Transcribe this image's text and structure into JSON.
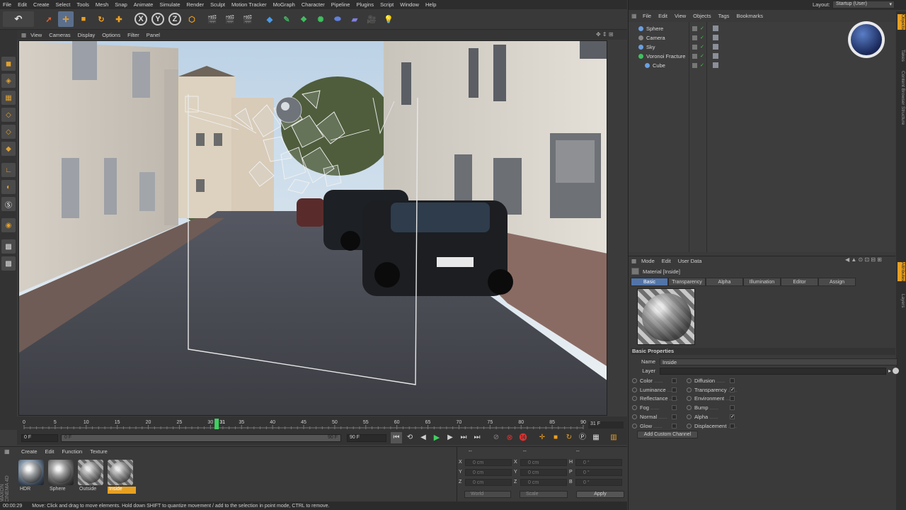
{
  "menu": [
    "File",
    "Edit",
    "Create",
    "Select",
    "Tools",
    "Mesh",
    "Snap",
    "Animate",
    "Simulate",
    "Render",
    "Sculpt",
    "Motion Tracker",
    "MoGraph",
    "Character",
    "Pipeline",
    "Plugins",
    "Script",
    "Window",
    "Help"
  ],
  "toolbar": {
    "axis_x": "X",
    "axis_y": "Y",
    "axis_z": "Z"
  },
  "viewport_menu": [
    "View",
    "Cameras",
    "Display",
    "Options",
    "Filter",
    "Panel"
  ],
  "timeline": {
    "ticks": [
      "0",
      "5",
      "10",
      "15",
      "20",
      "25",
      "30",
      "35",
      "40",
      "45",
      "50",
      "55",
      "60",
      "65",
      "70",
      "75",
      "80",
      "85",
      "90"
    ],
    "current_marker": "31",
    "end_frame_label": "31 F",
    "start_field": "0 F",
    "range_start": "0 F",
    "range_end": "90 F",
    "end_field": "90 F"
  },
  "material_manager": {
    "menu": [
      "Create",
      "Edit",
      "Function",
      "Texture"
    ],
    "materials": [
      {
        "name": "HDR",
        "selected": false
      },
      {
        "name": "Sphere",
        "selected": false
      },
      {
        "name": "Outside",
        "selected": false
      },
      {
        "name": "Inside",
        "selected": true
      }
    ]
  },
  "coordinates": {
    "header_a": "--",
    "header_b": "--",
    "header_c": "--",
    "rows": [
      {
        "a": "X",
        "av": "0 cm",
        "b": "X",
        "bv": "0 cm",
        "c": "H",
        "cv": "0 °"
      },
      {
        "a": "Y",
        "av": "0 cm",
        "b": "Y",
        "bv": "0 cm",
        "c": "P",
        "cv": "0 °"
      },
      {
        "a": "Z",
        "av": "0 cm",
        "b": "Z",
        "bv": "0 cm",
        "c": "B",
        "cv": "0 °"
      }
    ],
    "mode": "World",
    "scale": "Scale",
    "apply": "Apply"
  },
  "status": {
    "time": "00:00:29",
    "message": "Move: Click and drag to move elements. Hold down SHIFT to quantize movement / add to the selection in point mode, CTRL to remove."
  },
  "layout": {
    "label": "Layout:",
    "value": "Startup (User)"
  },
  "object_manager": {
    "menu": [
      "File",
      "Edit",
      "View",
      "Objects",
      "Tags",
      "Bookmarks"
    ],
    "objects": [
      {
        "name": "Sphere",
        "color": "#6aa0e0",
        "indent": 0
      },
      {
        "name": "Camera",
        "color": "#888888",
        "indent": 0
      },
      {
        "name": "Sky",
        "color": "#6aa0e0",
        "indent": 0
      },
      {
        "name": "Voronoi Fracture",
        "color": "#40c060",
        "indent": 0
      },
      {
        "name": "Cube",
        "color": "#6aa0e0",
        "indent": 1
      }
    ]
  },
  "side_tabs": [
    "Objects",
    "Takes",
    "Content Browser",
    "Structure",
    "Attributes",
    "Layers"
  ],
  "attributes": {
    "menu": [
      "Mode",
      "Edit",
      "User Data"
    ],
    "title": "Material [Inside]",
    "tabs": [
      {
        "label": "Basic",
        "active": true
      },
      {
        "label": "Transparency",
        "active": false
      },
      {
        "label": "Alpha",
        "active": false
      },
      {
        "label": "Illumination",
        "active": false
      },
      {
        "label": "Editor",
        "active": false
      },
      {
        "label": "Assign",
        "active": false
      }
    ],
    "section": "Basic Properties",
    "name_label": "Name",
    "name_value": "Inside",
    "layer_label": "Layer",
    "channels_left": [
      {
        "label": "Color",
        "checked": false
      },
      {
        "label": "Luminance",
        "checked": false
      },
      {
        "label": "Reflectance",
        "checked": false
      },
      {
        "label": "Fog",
        "checked": false
      },
      {
        "label": "Normal",
        "checked": false
      },
      {
        "label": "Glow",
        "checked": false
      }
    ],
    "channels_right": [
      {
        "label": "Diffusion",
        "checked": false
      },
      {
        "label": "Transparency",
        "checked": true
      },
      {
        "label": "Environment",
        "checked": false
      },
      {
        "label": "Bump",
        "checked": false
      },
      {
        "label": "Alpha",
        "checked": true
      },
      {
        "label": "Displacement",
        "checked": false
      }
    ],
    "add_custom": "Add Custom Channel"
  },
  "colors": {
    "accent": "#5274a8",
    "selected_material": "#e8a020",
    "green_marker": "#3fd060"
  }
}
